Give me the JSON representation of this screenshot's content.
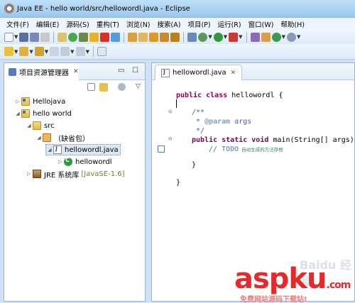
{
  "window": {
    "title": "Java EE - hello world/src/hellowordl.java - Eclipse"
  },
  "menu": [
    "文件(F)",
    "编辑(E)",
    "源码(S)",
    "重构(T)",
    "浏览(N)",
    "搜索(A)",
    "项目(P)",
    "运行(R)",
    "窗口(W)",
    "帮助(H)"
  ],
  "explorer": {
    "tab_label": "项目资源管理器",
    "tree": [
      {
        "label": "Hellojava"
      },
      {
        "label": "hello world"
      },
      {
        "label": "src"
      },
      {
        "label": "（缺省包）"
      },
      {
        "label": "hellowordl.java"
      },
      {
        "label": "hellowordl"
      },
      {
        "label": "JRE 系统库",
        "tag": "[JavaSE-1.6]"
      }
    ]
  },
  "editor": {
    "tab_label": "hellowordl.java",
    "lines": {
      "l1_kw": "public class",
      "l1_rest": " hellowordl {",
      "l2": "/**",
      "l3_star": " * ",
      "l3_tag": "@param",
      "l3_rest": " args",
      "l4": " */",
      "l5_kw1": "public static void",
      "l5_rest": " main(String[] args) {",
      "l6_slashes": "// ",
      "l6_todo": "TODO",
      "l6_text": " 自动生成的方法存根",
      "l7": "}",
      "l8": "}"
    }
  },
  "watermark": {
    "big": "aspku",
    "dotcom": ".com",
    "small": "免费网站源码下载站!",
    "cn": "Baidu 经验"
  },
  "colors": {
    "keyword": "#7f0055",
    "javadoc": "#3f5fbf",
    "comment": "#3f7f5f",
    "watermark": "#e32b2b"
  }
}
